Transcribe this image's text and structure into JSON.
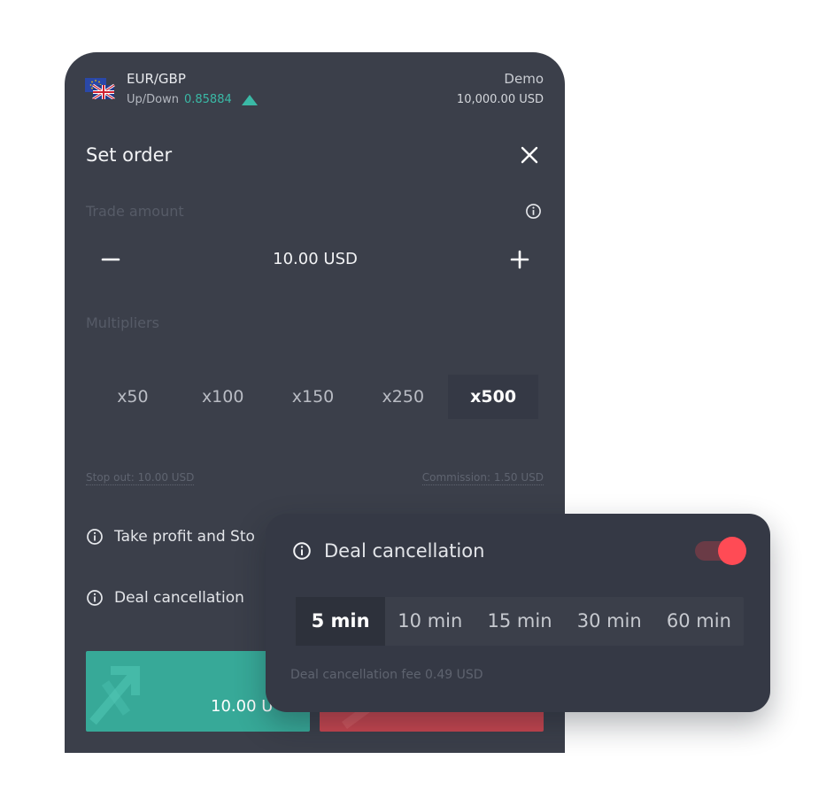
{
  "header": {
    "pair": "EUR/GBP",
    "mode_label": "Up/Down",
    "price": "0.85884",
    "account_type": "Demo",
    "balance": "10,000.00 USD",
    "price_color": "#3ab9a6"
  },
  "order": {
    "title": "Set order",
    "trade_amount_label": "Trade amount",
    "amount": "10.00 USD",
    "multipliers_label": "Multipliers",
    "multipliers": [
      "x50",
      "x100",
      "x150",
      "x250",
      "x500"
    ],
    "selected_multiplier": "x500",
    "stop_out": "Stop out: 10.00 USD",
    "commission": "Commission: 1.50 USD",
    "take_profit_label": "Take profit and Sto",
    "deal_cancellation_label": "Deal cancellation",
    "buy_amount": "10.00 U",
    "buy_color": "#37a998",
    "sell_color": "#c84650"
  },
  "popup": {
    "title": "Deal cancellation",
    "toggle_on": true,
    "durations": [
      "5 min",
      "10 min",
      "15 min",
      "30 min",
      "60 min"
    ],
    "selected_duration": "5 min",
    "fee_text": "Deal cancellation fee 0.49 USD",
    "toggle_color": "#ff4b55"
  }
}
